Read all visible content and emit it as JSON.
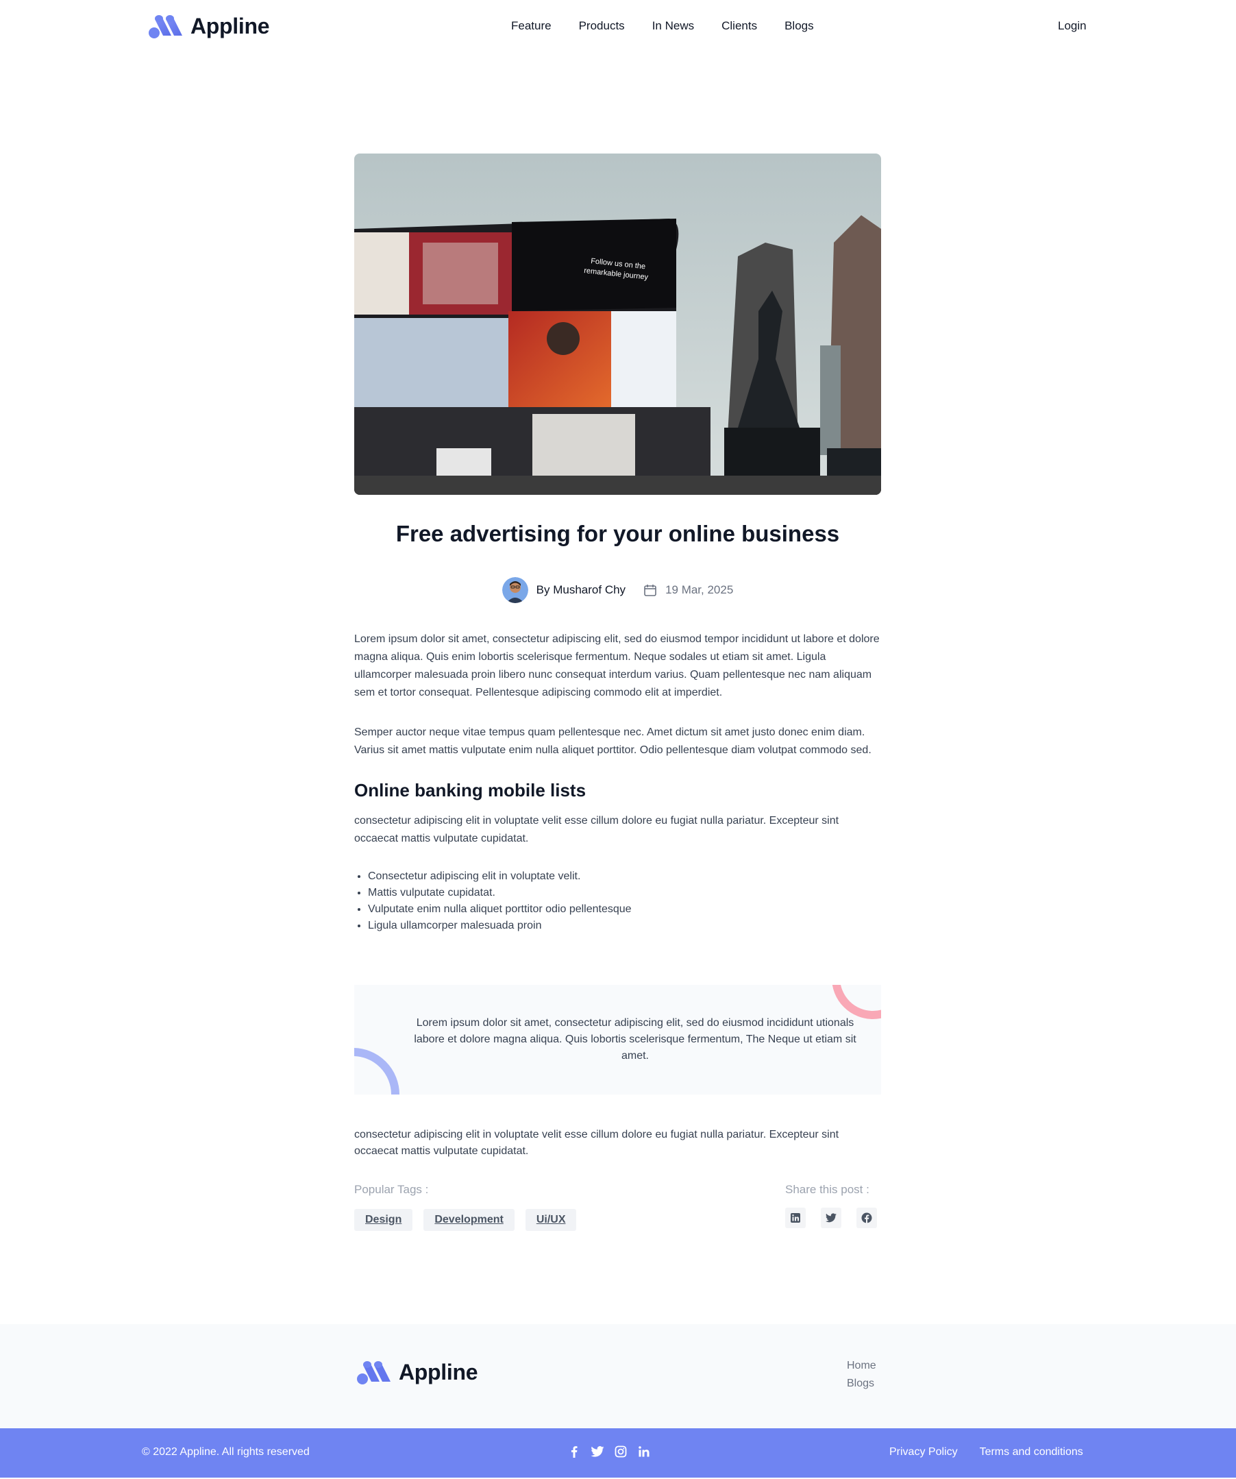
{
  "header": {
    "brand_name": "Appline",
    "nav": [
      "Feature",
      "Products",
      "In News",
      "Clients",
      "Blogs"
    ],
    "login_label": "Login"
  },
  "article": {
    "title": "Free advertising for your online business",
    "author": "By Musharof Chy",
    "date": "19 Mar, 2025",
    "paragraph1": "Lorem ipsum dolor sit amet, consectetur adipiscing elit, sed do eiusmod tempor incididunt ut labore et dolore magna aliqua. Quis enim lobortis scelerisque fermentum. Neque sodales ut etiam sit amet. Ligula ullamcorper malesuada proin libero nunc consequat interdum varius. Quam pellentesque nec nam aliquam sem et tortor consequat. Pellentesque adipiscing commodo elit at imperdiet.",
    "paragraph2": "Semper auctor neque vitae tempus quam pellentesque nec. Amet dictum sit amet justo donec enim diam. Varius sit amet mattis vulputate enim nulla aliquet porttitor. Odio pellentesque diam volutpat commodo sed.",
    "subheading": "Online banking mobile lists",
    "paragraph3": "consectetur adipiscing elit in voluptate velit esse cillum dolore eu fugiat nulla pariatur. Excepteur sint occaecat mattis vulputate cupidatat.",
    "bullets": [
      "Consectetur adipiscing elit in voluptate velit.",
      "Mattis vulputate cupidatat.",
      "Vulputate enim nulla aliquet porttitor odio pellentesque",
      "Ligula ullamcorper malesuada proin"
    ],
    "quote": "Lorem ipsum dolor sit amet, consectetur adipiscing elit, sed do eiusmod incididunt utionals labore et dolore magna aliqua. Quis lobortis scelerisque fermentum, The Neque ut etiam sit amet.",
    "paragraph4": "consectetur adipiscing elit in voluptate velit esse cillum dolore eu fugiat nulla pariatur. Excepteur sint occaecat mattis vulputate cupidatat.",
    "tags_label": "Popular Tags :",
    "tags": [
      "Design",
      "Development",
      "Ui/UX"
    ],
    "share_label": "Share this post :",
    "share_icons": [
      "linkedin-icon",
      "twitter-icon",
      "facebook-icon"
    ],
    "hero_image_text": "Follow us on the remarkable journey"
  },
  "footer": {
    "brand_name": "Appline",
    "links": [
      "Home",
      "Blogs"
    ],
    "copyright": "© 2022 Appline. All rights reserved",
    "social_icons": [
      "facebook-icon",
      "twitter-icon",
      "instagram-icon",
      "linkedin-icon"
    ],
    "legal": [
      "Privacy Policy",
      "Terms and conditions"
    ]
  },
  "colors": {
    "brand_accent": "#6f84f2",
    "heading": "#111827",
    "body_text": "#374151",
    "muted": "#9ca3af"
  }
}
